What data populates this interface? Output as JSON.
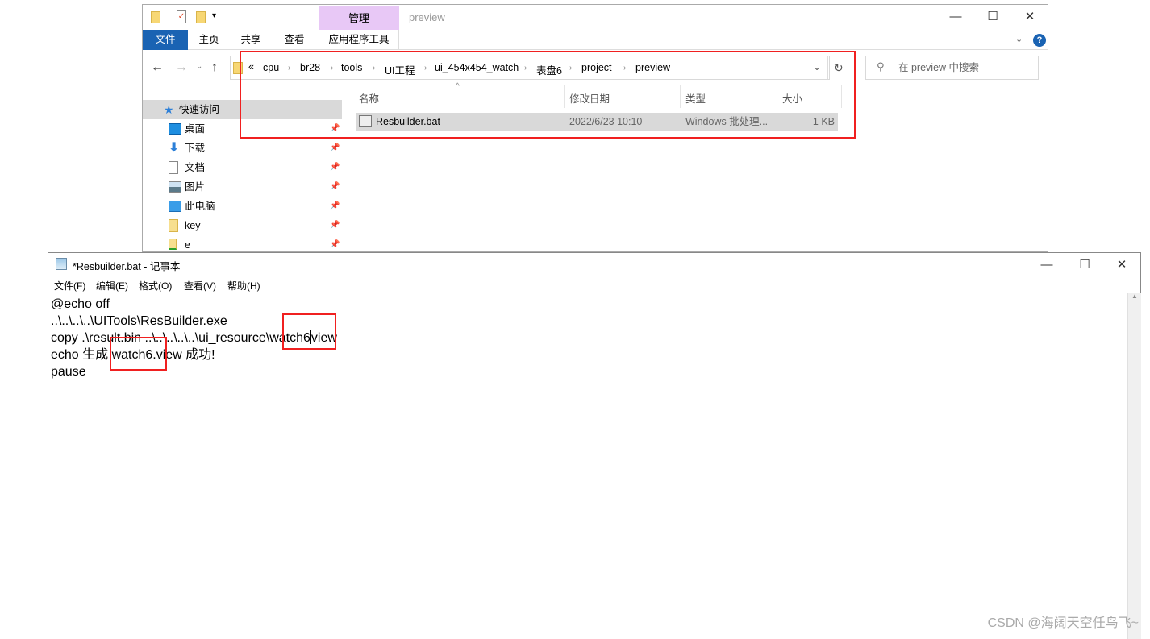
{
  "explorer": {
    "title": "preview",
    "contextual_tab": "管理",
    "ribbon_tabs": [
      "文件",
      "主页",
      "共享",
      "查看",
      "应用程序工具"
    ],
    "breadcrumb": [
      "cpu",
      "br28",
      "tools",
      "UI工程",
      "ui_454x454_watch",
      "表盘6",
      "project",
      "preview"
    ],
    "search_placeholder": "在 preview 中搜索",
    "sidebar": [
      {
        "label": "快速访问",
        "icon": "star-icon"
      },
      {
        "label": "桌面",
        "icon": "desktop-icon"
      },
      {
        "label": "下载",
        "icon": "download-icon"
      },
      {
        "label": "文档",
        "icon": "document-icon"
      },
      {
        "label": "图片",
        "icon": "pictures-icon"
      },
      {
        "label": "此电脑",
        "icon": "computer-icon"
      },
      {
        "label": "key",
        "icon": "folder-icon"
      },
      {
        "label": "e",
        "icon": "network-folder-icon"
      }
    ],
    "columns": [
      "名称",
      "修改日期",
      "类型",
      "大小"
    ],
    "files": [
      {
        "name": "Resbuilder.bat",
        "modified": "2022/6/23 10:10",
        "type": "Windows 批处理...",
        "size": "1 KB"
      }
    ],
    "highlight_color": "#f02020"
  },
  "notepad": {
    "title": "*Resbuilder.bat - 记事本",
    "menu": [
      "文件(F)",
      "编辑(E)",
      "格式(O)",
      "查看(V)",
      "帮助(H)"
    ],
    "lines": [
      "@echo off",
      "..\\..\\..\\..\\UITools\\ResBuilder.exe",
      "copy .\\result.bin ..\\..\\..\\..\\..\\ui_resource\\watch6",
      "view",
      "echo 生成 watch6.view 成功!",
      "pause"
    ]
  },
  "watermark": "CSDN @海阔天空任鸟飞~"
}
